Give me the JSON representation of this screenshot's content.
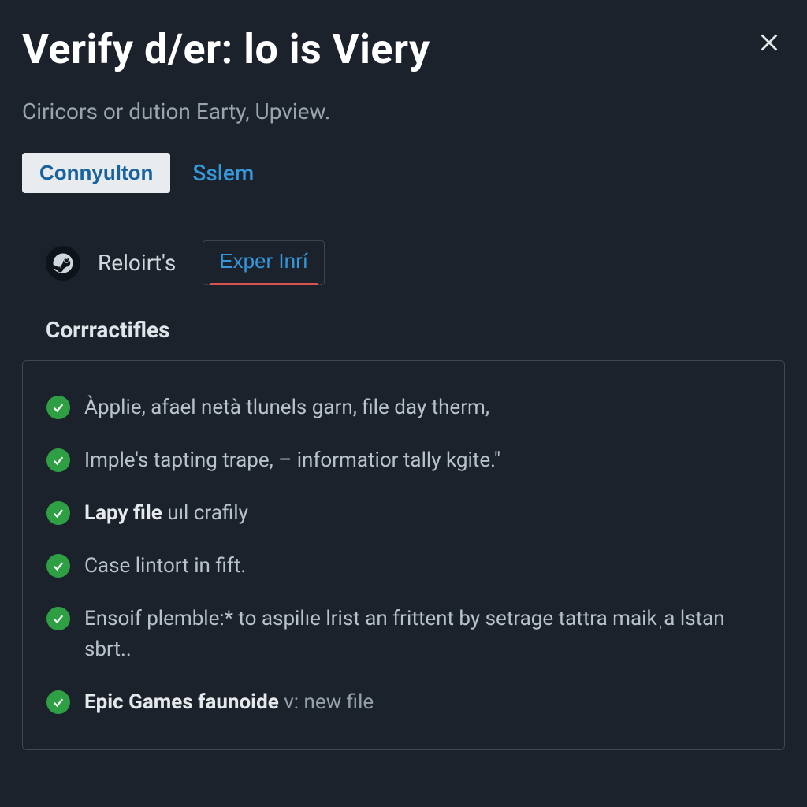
{
  "header": {
    "title": "Verify d/er: lo is Viery"
  },
  "subtitle": "Ciricors or dution Earty, Upview.",
  "primary": {
    "button_label": "Connyulton",
    "link_label": "Sslem"
  },
  "secondary": {
    "reloirts_label": "Reloirt's",
    "exper_label": "Exper Inrí"
  },
  "section_heading": "Corrractifles",
  "items": [
    {
      "prefix": "",
      "bold": "",
      "rest": "Àpplie, afael netà tlunels garn, file day therm,",
      "muted": ""
    },
    {
      "prefix": "",
      "bold": "",
      "rest": "Imple's tapting trape, – informatior tally kgite.\"",
      "muted": ""
    },
    {
      "prefix": "",
      "bold": "Lapy file",
      "rest": " uıl crafily",
      "muted": ""
    },
    {
      "prefix": "",
      "bold": "",
      "rest": "Case lintort in fift.",
      "muted": ""
    },
    {
      "prefix": "",
      "bold": "",
      "rest": "Ensoif plemble:* to aspilıe lrist an frittent by setrage tattra maikˌa lstan sbrt..",
      "muted": ""
    },
    {
      "prefix": "",
      "bold": "Epic Games faunoide",
      "rest": " ",
      "muted": "v: new file"
    }
  ]
}
